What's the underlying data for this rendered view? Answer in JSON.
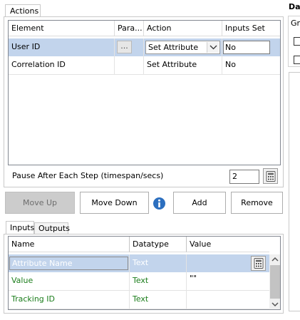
{
  "actions_tab": {
    "label": "Actions"
  },
  "actions_grid": {
    "headers": [
      "Element",
      "Para...",
      "Action",
      "Inputs Set"
    ],
    "rows": [
      {
        "element": "User ID",
        "param_button": "...",
        "action": "Set Attribute",
        "inputs_set": "No"
      },
      {
        "element": "Correlation ID",
        "action": "Set Attribute",
        "inputs_set": "No"
      }
    ]
  },
  "pause": {
    "label": "Pause After Each Step (timespan/secs)",
    "value": "2"
  },
  "buttons": {
    "move_up": "Move Up",
    "move_down": "Move Down",
    "add": "Add",
    "remove": "Remove"
  },
  "inputs_tabs": {
    "inputs": "Inputs",
    "outputs": "Outputs"
  },
  "inputs_grid": {
    "headers": [
      "Name",
      "Datatype",
      "Value"
    ],
    "rows": [
      {
        "name": "Attribute Name",
        "datatype": "Text",
        "value": ""
      },
      {
        "name": "Value",
        "datatype": "Text",
        "value": "\"\""
      },
      {
        "name": "Tracking ID",
        "datatype": "Text",
        "value": ""
      }
    ]
  },
  "right_panel": {
    "title_partial": "Dat",
    "group_partial": "Gr"
  },
  "colors": {
    "selection": "#c2d4ec",
    "green_text": "#1b7d1b",
    "info_blue": "#2c6fbf"
  }
}
